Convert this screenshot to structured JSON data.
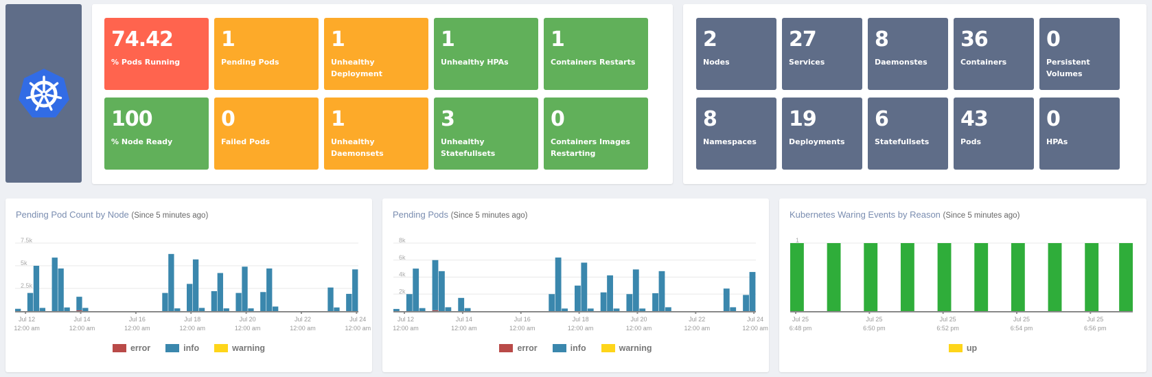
{
  "logo": {
    "icon": "kubernetes-helm-icon",
    "color": "#326ce5"
  },
  "health_tiles": [
    {
      "value": "74.42",
      "label": "% Pods Running",
      "status": "red"
    },
    {
      "value": "1",
      "label": "Pending Pods",
      "status": "orange"
    },
    {
      "value": "1",
      "label": "Unhealthy Deployment",
      "status": "orange"
    },
    {
      "value": "1",
      "label": "Unhealthy HPAs",
      "status": "green"
    },
    {
      "value": "1",
      "label": "Containers Restarts",
      "status": "green"
    },
    {
      "value": "100",
      "label": "% Node Ready",
      "status": "green"
    },
    {
      "value": "0",
      "label": "Failed Pods",
      "status": "orange"
    },
    {
      "value": "1",
      "label": "Unhealthy Daemonsets",
      "status": "orange"
    },
    {
      "value": "3",
      "label": "Unhealthy Statefullsets",
      "status": "green"
    },
    {
      "value": "0",
      "label": "Containers Images Restarting",
      "status": "green"
    }
  ],
  "inventory_tiles": [
    {
      "value": "2",
      "label": "Nodes"
    },
    {
      "value": "27",
      "label": "Services"
    },
    {
      "value": "8",
      "label": "Daemonstes"
    },
    {
      "value": "36",
      "label": "Containers"
    },
    {
      "value": "0",
      "label": "Persistent Volumes"
    },
    {
      "value": "8",
      "label": "Namespaces"
    },
    {
      "value": "19",
      "label": "Deployments"
    },
    {
      "value": "6",
      "label": "Statefullsets"
    },
    {
      "value": "43",
      "label": "Pods"
    },
    {
      "value": "0",
      "label": "HPAs"
    }
  ],
  "colors": {
    "red": "#ff644e",
    "orange": "#fdaa29",
    "green": "#61b05a",
    "slate": "#5f6d88",
    "error": "#b94a48",
    "info": "#3a87ad",
    "warning": "#fed51a",
    "up_bar": "#2fad3a",
    "up_legend": "#fed51a"
  },
  "chart_data": [
    {
      "type": "bar",
      "title": "Pending Pod Count by Node",
      "subtitle": "(Since 5 minutes ago)",
      "stacked": true,
      "ylim": [
        0,
        7500
      ],
      "yticks": [
        "2.5k",
        "5k",
        "7.5k"
      ],
      "ytick_values": [
        2500,
        5000,
        7500
      ],
      "xticks": [
        [
          "Jul 12",
          "12:00 am"
        ],
        [
          "Jul 14",
          "12:00 am"
        ],
        [
          "Jul 16",
          "12:00 am"
        ],
        [
          "Jul 18",
          "12:00 am"
        ],
        [
          "Jul 20",
          "12:00 am"
        ],
        [
          "Jul 22",
          "12:00 am"
        ],
        [
          "Jul 24",
          "12:00 am"
        ]
      ],
      "xtick_bins": [
        1.7,
        10.7,
        19.7,
        28.7,
        37.7,
        46.7,
        55.7
      ],
      "bins": 56,
      "series": [
        {
          "name": "error",
          "color": "#b94a48",
          "values": [
            0,
            0,
            0,
            0,
            0,
            0,
            0,
            0,
            0,
            0,
            80,
            0,
            0,
            0,
            0,
            0,
            0,
            0,
            0,
            0,
            0,
            0,
            0,
            0,
            0,
            0,
            0,
            0,
            0,
            0,
            0,
            0,
            0,
            0,
            0,
            0,
            0,
            0,
            0,
            0,
            0,
            0,
            0,
            0,
            0,
            0,
            0,
            0,
            0,
            0,
            0,
            0,
            0,
            0,
            0,
            0
          ]
        },
        {
          "name": "info",
          "color": "#3a87ad",
          "values": [
            250,
            0,
            2000,
            5000,
            350,
            0,
            5900,
            4700,
            400,
            0,
            1500,
            350,
            0,
            0,
            0,
            0,
            0,
            0,
            0,
            0,
            0,
            0,
            0,
            0,
            2000,
            6300,
            300,
            0,
            3000,
            5700,
            350,
            0,
            2200,
            4200,
            300,
            0,
            2000,
            4900,
            300,
            0,
            2100,
            4700,
            500,
            0,
            0,
            0,
            0,
            0,
            0,
            0,
            0,
            2600,
            400,
            0,
            1900,
            4600
          ]
        },
        {
          "name": "warning",
          "color": "#fed51a",
          "values": [
            0,
            0,
            0,
            0,
            0,
            0,
            0,
            0,
            0,
            0,
            0,
            0,
            0,
            0,
            0,
            0,
            0,
            0,
            0,
            0,
            0,
            0,
            0,
            0,
            0,
            0,
            0,
            0,
            0,
            0,
            0,
            0,
            0,
            0,
            0,
            0,
            0,
            0,
            0,
            0,
            0,
            0,
            0,
            0,
            0,
            0,
            0,
            0,
            0,
            0,
            0,
            0,
            0,
            0,
            0,
            0
          ]
        }
      ],
      "legend": [
        "error",
        "info",
        "warning"
      ],
      "legend_position": "bottom"
    },
    {
      "type": "bar",
      "title": "Pending Pods",
      "subtitle": "(Since 5 minutes ago)",
      "stacked": true,
      "ylim": [
        0,
        8000
      ],
      "yticks": [
        "2k",
        "4k",
        "6k",
        "8k"
      ],
      "ytick_values": [
        2000,
        4000,
        6000,
        8000
      ],
      "xticks": [
        [
          "Jul 12",
          "12:00 am"
        ],
        [
          "Jul 14",
          "12:00 am"
        ],
        [
          "Jul 16",
          "12:00 am"
        ],
        [
          "Jul 18",
          "12:00 am"
        ],
        [
          "Jul 20",
          "12:00 am"
        ],
        [
          "Jul 22",
          "12:00 am"
        ],
        [
          "Jul 24",
          "12:00 am"
        ]
      ],
      "xtick_bins": [
        1.7,
        10.7,
        19.7,
        28.7,
        37.7,
        46.7,
        55.7
      ],
      "bins": 56,
      "series": [
        {
          "name": "error",
          "color": "#b94a48",
          "values": [
            0,
            0,
            0,
            0,
            0,
            0,
            100,
            0,
            0,
            0,
            0,
            0,
            0,
            0,
            0,
            0,
            0,
            0,
            0,
            0,
            0,
            0,
            0,
            0,
            0,
            0,
            0,
            0,
            0,
            0,
            0,
            0,
            0,
            0,
            0,
            0,
            0,
            0,
            0,
            0,
            0,
            0,
            0,
            0,
            0,
            0,
            0,
            0,
            0,
            0,
            0,
            0,
            0,
            0,
            0,
            0
          ]
        },
        {
          "name": "info",
          "color": "#3a87ad",
          "values": [
            250,
            0,
            2000,
            5000,
            350,
            0,
            5900,
            4700,
            450,
            0,
            1550,
            350,
            0,
            0,
            0,
            0,
            0,
            0,
            0,
            0,
            0,
            0,
            0,
            0,
            2000,
            6300,
            300,
            0,
            3000,
            5700,
            300,
            0,
            2200,
            4200,
            300,
            0,
            2000,
            4900,
            300,
            0,
            2100,
            4700,
            450,
            0,
            0,
            0,
            0,
            0,
            0,
            0,
            0,
            2650,
            450,
            0,
            1900,
            4600
          ]
        },
        {
          "name": "warning",
          "color": "#fed51a",
          "values": [
            0,
            0,
            0,
            0,
            0,
            0,
            0,
            0,
            0,
            0,
            0,
            0,
            0,
            0,
            0,
            0,
            0,
            0,
            0,
            0,
            0,
            0,
            0,
            0,
            0,
            0,
            0,
            0,
            0,
            0,
            0,
            0,
            0,
            0,
            0,
            0,
            0,
            0,
            0,
            0,
            0,
            0,
            0,
            0,
            0,
            0,
            0,
            0,
            0,
            0,
            0,
            0,
            0,
            0,
            0,
            0
          ]
        }
      ],
      "legend": [
        "error",
        "info",
        "warning"
      ],
      "legend_position": "bottom"
    },
    {
      "type": "bar",
      "title": "Kubernetes Waring Events by Reason",
      "subtitle": "(Since 5 minutes ago)",
      "ylim": [
        0,
        1
      ],
      "yticks": [
        "1"
      ],
      "ytick_values": [
        1
      ],
      "xticks": [
        [
          "Jul 25",
          "6:48 pm"
        ],
        [
          "Jul 25",
          "6:50 pm"
        ],
        [
          "Jul 25",
          "6:52 pm"
        ],
        [
          "Jul 25",
          "6:54 pm"
        ],
        [
          "Jul 25",
          "6:56 pm"
        ]
      ],
      "xtick_minutes": [
        0.15,
        2.15,
        4.15,
        6.15,
        8.15
      ],
      "x_range_minutes": [
        0,
        9.3
      ],
      "series": [
        {
          "name": "up",
          "color": "#2fad3a",
          "x_minutes": [
            0,
            1.0,
            2.0,
            3.0,
            4.0,
            5.0,
            6.0,
            7.0,
            8.0,
            9.0
          ],
          "values": [
            1,
            1,
            1,
            1,
            1,
            1,
            1,
            1,
            1,
            1
          ]
        }
      ],
      "legend": [
        "up"
      ],
      "legend_position": "bottom"
    }
  ]
}
